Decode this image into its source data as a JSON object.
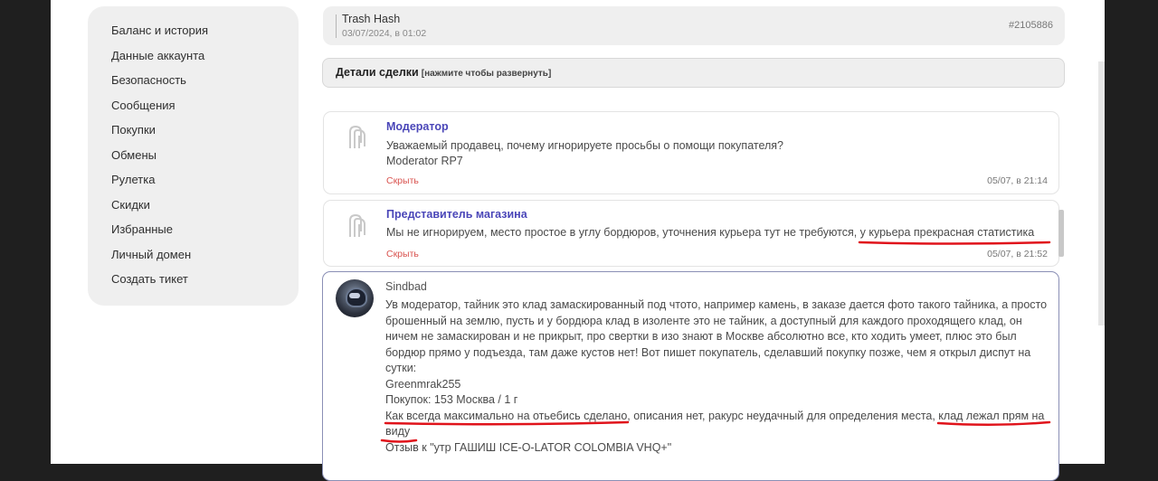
{
  "sidebar": {
    "items": [
      {
        "label": "Баланс и история"
      },
      {
        "label": "Данные аккаунта"
      },
      {
        "label": "Безопасность"
      },
      {
        "label": "Сообщения"
      },
      {
        "label": "Покупки"
      },
      {
        "label": "Обмены"
      },
      {
        "label": "Рулетка"
      },
      {
        "label": "Скидки"
      },
      {
        "label": "Избранные"
      },
      {
        "label": "Личный домен"
      },
      {
        "label": "Создать тикет"
      }
    ]
  },
  "order": {
    "title": "Trash Hash",
    "date": "03/07/2024, в 01:02",
    "id": "#2105886"
  },
  "details": {
    "label": "Детали сделки",
    "hint": "[нажмите чтобы развернуть]"
  },
  "messages": [
    {
      "author": "Модератор",
      "lines": [
        "Уважаемый продавец, почему игнорируете просьбы о помощи покупателя?",
        "Moderator RP7"
      ],
      "complain": "Скрыть",
      "time": "05/07, в 21:14"
    },
    {
      "author": "Представитель магазина",
      "lines": [
        "Мы не игнорируем, место простое в углу бордюров, уточнения курьера тут не требуются, у курьера прекрасная статистика"
      ],
      "complain": "Скрыть",
      "time": "05/07, в 21:52"
    },
    {
      "author": "Sindbad",
      "lines": [
        "Ув модератор, тайник это клад замаскированный под чтото, например камень, в заказе дается фото такого тайника, а просто",
        "брошенный на землю, пусть и у бордюра клад в изоленте это не тайник, а доступный для каждого проходящего клад, он",
        "ничем не замаскирован и не прикрыт, про свертки в изо знают в Москве абсолютно все, кто ходить умеет, плюс это был",
        "бордюр прямо у подъезда, там даже кустов нет! Вот пишет покупатель, сделавший покупку позже, чем я открыл диспут на",
        "сутки:",
        "Greenmrak255",
        "Покупок: 153 Москва / 1 г",
        "Как всегда максимально на отьебись сделано, описания нет, ракурс неудачный для определения места, клад лежал прям на",
        "виду",
        "Отзыв к \"утр ГАШИШ ICE-O-LATOR COLOMBIA VHQ+\""
      ]
    }
  ],
  "colors": {
    "accent": "#4a46b8",
    "complain": "#d9534f",
    "annotation": "#e0131b"
  }
}
